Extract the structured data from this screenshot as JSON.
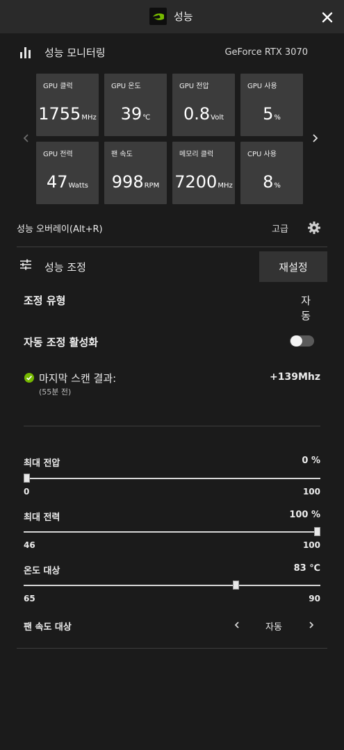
{
  "window": {
    "title": "성능",
    "logo_icon": "nvidia-logo-icon",
    "close_icon": "close-icon",
    "accent": "#76b900"
  },
  "monitor": {
    "title": "성능 모니터링",
    "gpu_model": "GeForce RTX 3070",
    "tiles": [
      {
        "label": "GPU 클럭",
        "value": "1755",
        "unit": "MHz"
      },
      {
        "label": "GPU 온도",
        "value": "39",
        "unit": "℃"
      },
      {
        "label": "GPU 전압",
        "value": "0.8",
        "unit": "Volt"
      },
      {
        "label": "GPU 사용",
        "value": "5",
        "unit": "%"
      },
      {
        "label": "GPU 전력",
        "value": "47",
        "unit": "Watts"
      },
      {
        "label": "팬 속도",
        "value": "998",
        "unit": "RPM"
      },
      {
        "label": "메모리 클럭",
        "value": "7200",
        "unit": "MHz"
      },
      {
        "label": "CPU 사용",
        "value": "8",
        "unit": "%"
      }
    ]
  },
  "overlay": {
    "label": "성능 오버레이(Alt+R)",
    "advanced": "고급"
  },
  "tuning": {
    "title": "성능 조정",
    "reset_label": "재설정",
    "type_label": "조정 유형",
    "type_value_1": "자",
    "type_value_2": "동",
    "auto_label": "자동 조정 활성화",
    "auto_enabled": false,
    "scan_label": "마지막 스캔 결과:",
    "scan_time": "(55분 전)",
    "scan_result": "+139Mhz",
    "sliders": [
      {
        "label": "최대 전압",
        "value": "0 %",
        "min": "0",
        "max": "100",
        "level": 0
      },
      {
        "label": "최대 전력",
        "value": "100 %",
        "min": "46",
        "max": "100",
        "level": 1
      },
      {
        "label": "온도 대상",
        "value": "83 ℃",
        "min": "65",
        "max": "90",
        "level": 0.72
      }
    ],
    "fan_label": "팬 속도 대상",
    "fan_value": "자동"
  }
}
